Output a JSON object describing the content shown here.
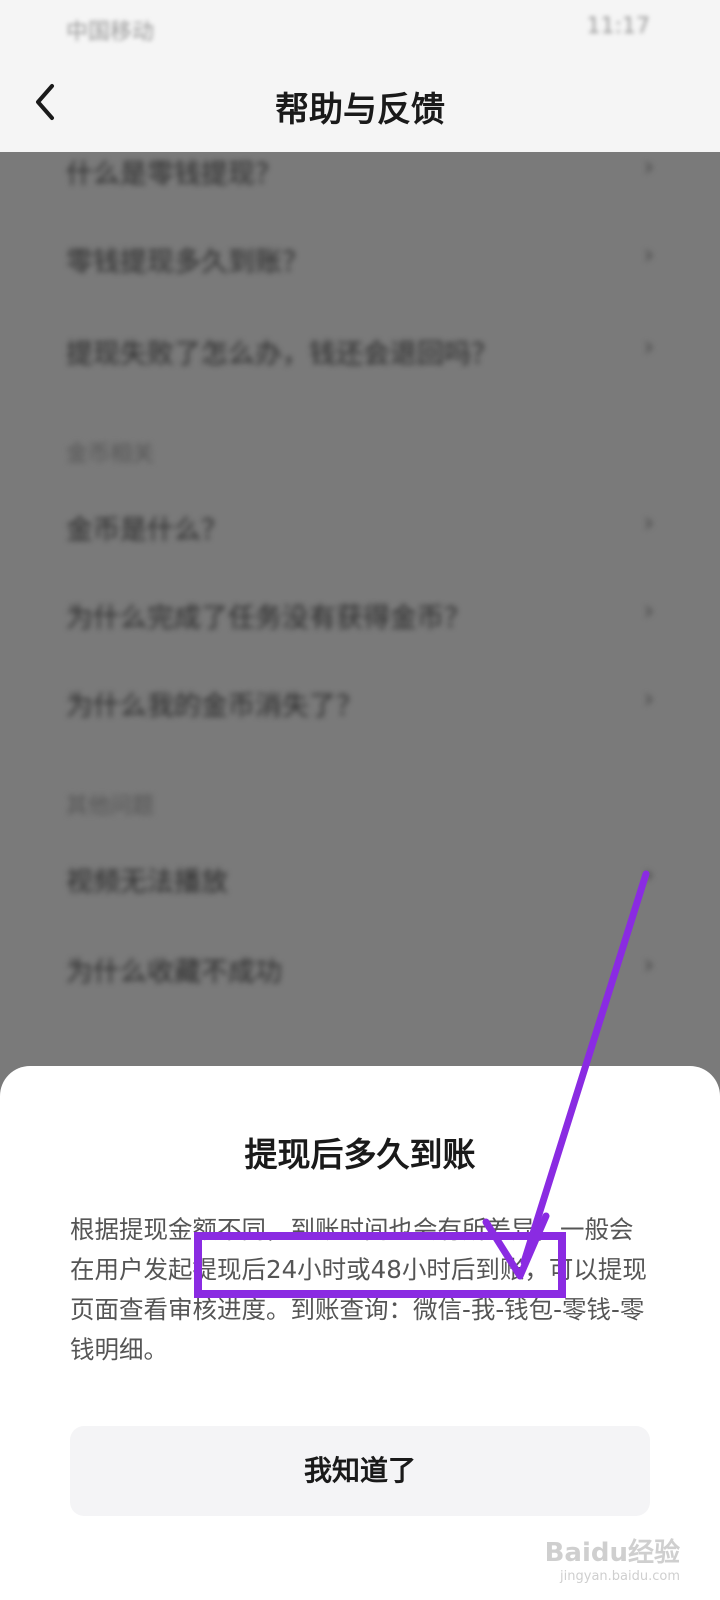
{
  "status_bar": {
    "carrier": "中国移动",
    "right": "11:17"
  },
  "header": {
    "title": "帮助与反馈"
  },
  "background_list": {
    "rows_group1": [
      "什么是零钱提现？",
      "零钱提现多久到账？",
      "提现失败了怎么办，钱还会退回吗？"
    ],
    "section2": "金币相关",
    "rows_group2": [
      "金币是什么？",
      "为什么完成了任务没有获得金币？",
      "为什么我的金币消失了？"
    ],
    "section3": "其他问题",
    "rows_group3": [
      "视频无法播放",
      "为什么收藏不成功"
    ]
  },
  "sheet": {
    "title": "提现后多久到账",
    "body": "根据提现金额不同，到账时间也会有所差异，一般会在用户发起提现后24小时或48小时后到账，可以提现页面查看审核进度。到账查询：微信-我-钱包-零钱-零钱明细。",
    "ok_label": "我知道了"
  },
  "annotation": {
    "color": "#8a2be2"
  },
  "watermark": {
    "brand": "Baidu经验",
    "url": "jingyan.baidu.com"
  }
}
